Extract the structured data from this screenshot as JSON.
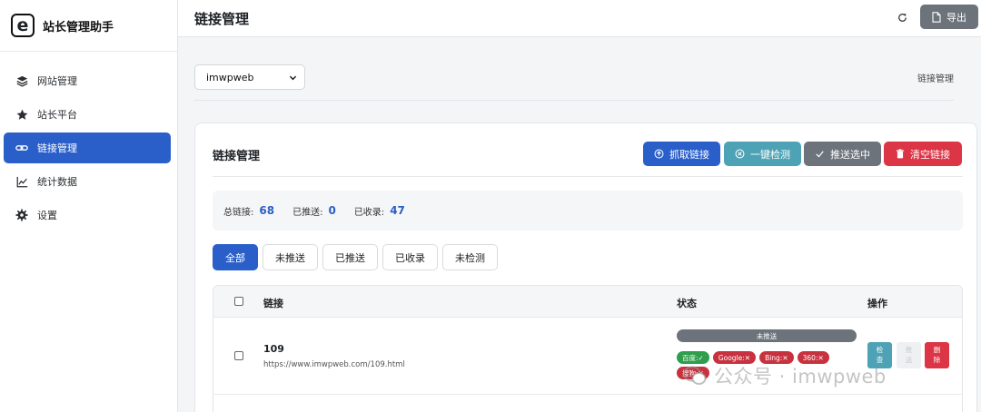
{
  "brand": {
    "name": "站长管理助手",
    "logo_letter": "e"
  },
  "sidebar": {
    "items": [
      {
        "label": "网站管理",
        "icon": "layers-icon",
        "active": false
      },
      {
        "label": "站长平台",
        "icon": "star-icon",
        "active": false
      },
      {
        "label": "链接管理",
        "icon": "link-icon",
        "active": true
      },
      {
        "label": "统计数据",
        "icon": "chart-icon",
        "active": false
      },
      {
        "label": "设置",
        "icon": "gear-icon",
        "active": false
      }
    ]
  },
  "header": {
    "title": "链接管理",
    "refresh_icon": "refresh-icon",
    "export_label": "导出"
  },
  "site_select": {
    "value": "imwpweb"
  },
  "breadcrumb": "链接管理",
  "card": {
    "title": "链接管理",
    "actions": {
      "fetch": "抓取链接",
      "check_all": "一键检测",
      "push_selected": "推送选中",
      "clear": "清空链接"
    }
  },
  "stats": {
    "total_label": "总链接:",
    "total": "68",
    "pushed_label": "已推送:",
    "pushed": "0",
    "indexed_label": "已收录:",
    "indexed": "47"
  },
  "filters": [
    "全部",
    "未推送",
    "已推送",
    "已收录",
    "未检测"
  ],
  "table": {
    "headers": {
      "link": "链接",
      "status": "状态",
      "ops": "操作"
    },
    "rows": [
      {
        "id": "109",
        "url": "https://www.imwpweb.com/109.html",
        "status": "未推送",
        "tags": [
          {
            "label": "百度:✓",
            "ok": true
          },
          {
            "label": "Google:✕",
            "ok": false
          },
          {
            "label": "Bing:✕",
            "ok": false
          },
          {
            "label": "360:✕",
            "ok": false
          },
          {
            "label": "搜狗:✕",
            "ok": false
          }
        ],
        "ops": {
          "check": [
            "检",
            "查"
          ],
          "push": [
            "推",
            "送"
          ],
          "del": [
            "删",
            "除"
          ]
        }
      }
    ]
  },
  "watermark": "公众号 · imwpweb",
  "colors": {
    "primary": "#2a5fc9",
    "info": "#4da3b5",
    "secondary": "#6c737b",
    "danger": "#dc3545",
    "success": "#2e9e4a"
  }
}
